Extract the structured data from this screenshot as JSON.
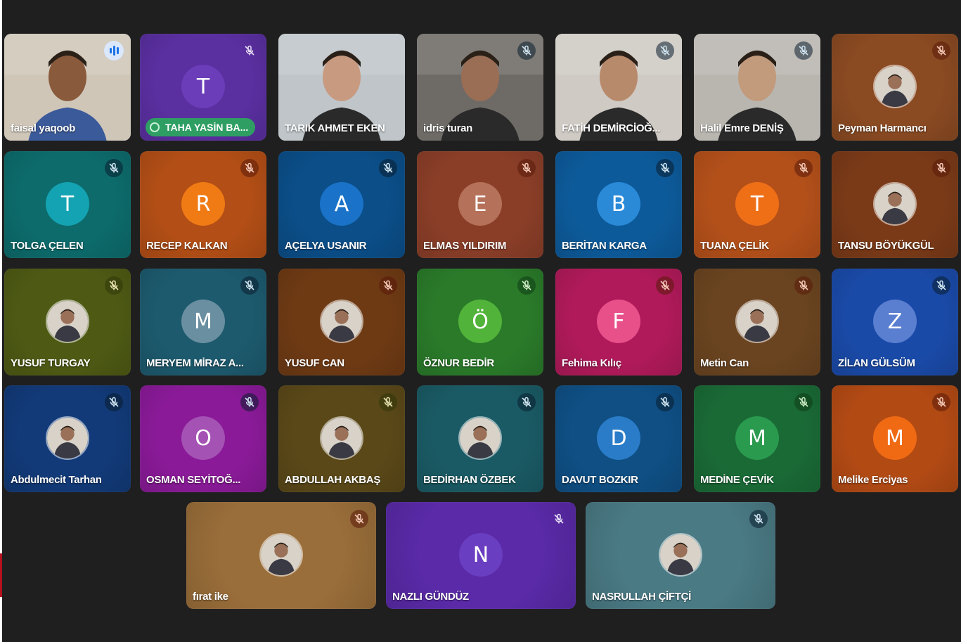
{
  "colors": {
    "background": "#1f1f1f",
    "speaking_ring": "#8ab4f8",
    "raised_hand_pill": "#2f9e63",
    "mic_badge_dark": "#1c3b52",
    "mic_badge_red": "#8c3a22"
  },
  "participants": [
    {
      "name": "faisal yaqoob",
      "kind": "video",
      "speaking": true,
      "bg": "#cfc6b8",
      "skin": "#8a5a3c"
    },
    {
      "name": "TAHA YASİN BA...",
      "kind": "initial",
      "initial": "T",
      "bg": "#5a2fa0",
      "avatar": "#6b3db8",
      "mic": "light",
      "raised_hand": true
    },
    {
      "name": "TARIK AHMET EKEN",
      "kind": "video",
      "bg": "#bfc5c9",
      "skin": "#c89a80"
    },
    {
      "name": "idris turan",
      "kind": "video",
      "bg": "#6e6a66",
      "skin": "#9a6e55",
      "mic": "dark"
    },
    {
      "name": "FATİH DEMİRCİOĞ...",
      "kind": "video",
      "bg": "#cfcac3",
      "skin": "#b88a6c",
      "mic": "dark"
    },
    {
      "name": "Halil Emre DENİŞ",
      "kind": "video",
      "bg": "#b9b6b0",
      "skin": "#c29a7c",
      "mic": "dark"
    },
    {
      "name": "Peyman Harmancı",
      "kind": "photo",
      "bg": "#8a4a22",
      "mic": "red"
    },
    {
      "name": "TOLGA ÇELEN",
      "kind": "initial",
      "initial": "T",
      "bg": "#0d6b6b",
      "avatar": "#14a3b3",
      "mic": "dark"
    },
    {
      "name": "RECEP KALKAN",
      "kind": "initial",
      "initial": "R",
      "bg": "#b24e16",
      "avatar": "#f07a14",
      "mic": "red"
    },
    {
      "name": "AÇELYA USANIR",
      "kind": "initial",
      "initial": "A",
      "bg": "#0b4e88",
      "avatar": "#1a73c8",
      "mic": "dark"
    },
    {
      "name": "ELMAS YILDIRIM",
      "kind": "initial",
      "initial": "E",
      "bg": "#8a3e28",
      "avatar": "#b5715a",
      "mic": "red"
    },
    {
      "name": "BERİTAN KARGA",
      "kind": "initial",
      "initial": "B",
      "bg": "#0d5a9a",
      "avatar": "#2a8ad8",
      "mic": "dark"
    },
    {
      "name": "TUANA ÇELİK",
      "kind": "initial",
      "initial": "T",
      "bg": "#b3501a",
      "avatar": "#ef6f17",
      "mic": "red"
    },
    {
      "name": "TANSU BÖYÜKGÜL",
      "kind": "photo",
      "bg": "#7a3a18",
      "mic": "red"
    },
    {
      "name": "YUSUF TURGAY",
      "kind": "photo",
      "bg": "#4e5a14",
      "mic": "olive"
    },
    {
      "name": "MERYEM MİRAZ A...",
      "kind": "initial",
      "initial": "M",
      "bg": "#1d5a6e",
      "avatar": "#6a8fa0",
      "mic": "dark"
    },
    {
      "name": "YUSUF CAN",
      "kind": "photo",
      "bg": "#6e3a14",
      "mic": "red"
    },
    {
      "name": "ÖZNUR BEDİR",
      "kind": "initial",
      "initial": "Ö",
      "bg": "#2a7a2a",
      "avatar": "#52b33a",
      "mic": "green"
    },
    {
      "name": "Fehima Kılıç",
      "kind": "initial",
      "initial": "F",
      "bg": "#b01a5a",
      "avatar": "#e8508a",
      "mic": "red"
    },
    {
      "name": "Metin Can",
      "kind": "photo",
      "bg": "#6a4420",
      "mic": "red"
    },
    {
      "name": "ZİLAN GÜLSÜM",
      "kind": "initial",
      "initial": "Z",
      "bg": "#1a4aa8",
      "avatar": "#5a7ed0",
      "mic": "dark"
    },
    {
      "name": "Abdulmecit Tarhan",
      "kind": "photo",
      "bg": "#123a78",
      "mic": "dark"
    },
    {
      "name": "OSMAN SEYİTOĞ...",
      "kind": "initial",
      "initial": "O",
      "bg": "#8a1a98",
      "avatar": "#a452b3",
      "mic": "dark"
    },
    {
      "name": "ABDULLAH AKBAŞ",
      "kind": "photo",
      "bg": "#5a4818",
      "mic": "olive"
    },
    {
      "name": "BEDİRHAN ÖZBEK",
      "kind": "photo",
      "bg": "#1a5a64",
      "mic": "dark"
    },
    {
      "name": "DAVUT BOZKIR",
      "kind": "initial",
      "initial": "D",
      "bg": "#0f4f84",
      "avatar": "#2a7cc8",
      "mic": "dark"
    },
    {
      "name": "MEDİNE ÇEVİK",
      "kind": "initial",
      "initial": "M",
      "bg": "#1a6a36",
      "avatar": "#2a9a4e",
      "mic": "green"
    },
    {
      "name": "Melike Erciyas",
      "kind": "initial",
      "initial": "M",
      "bg": "#b24a14",
      "avatar": "#f06a14",
      "mic": "red"
    },
    {
      "name": "fırat ike",
      "kind": "photo",
      "bg": "#9a6e3a",
      "mic": "red"
    },
    {
      "name": "NAZLI GÜNDÜZ",
      "kind": "initial",
      "initial": "N",
      "bg": "#5a2aa8",
      "avatar": "#6a3ec0",
      "mic": "light"
    },
    {
      "name": "NASRULLAH ÇİFTÇİ",
      "kind": "photo",
      "bg": "#4a7a84",
      "mic": "dark"
    }
  ]
}
